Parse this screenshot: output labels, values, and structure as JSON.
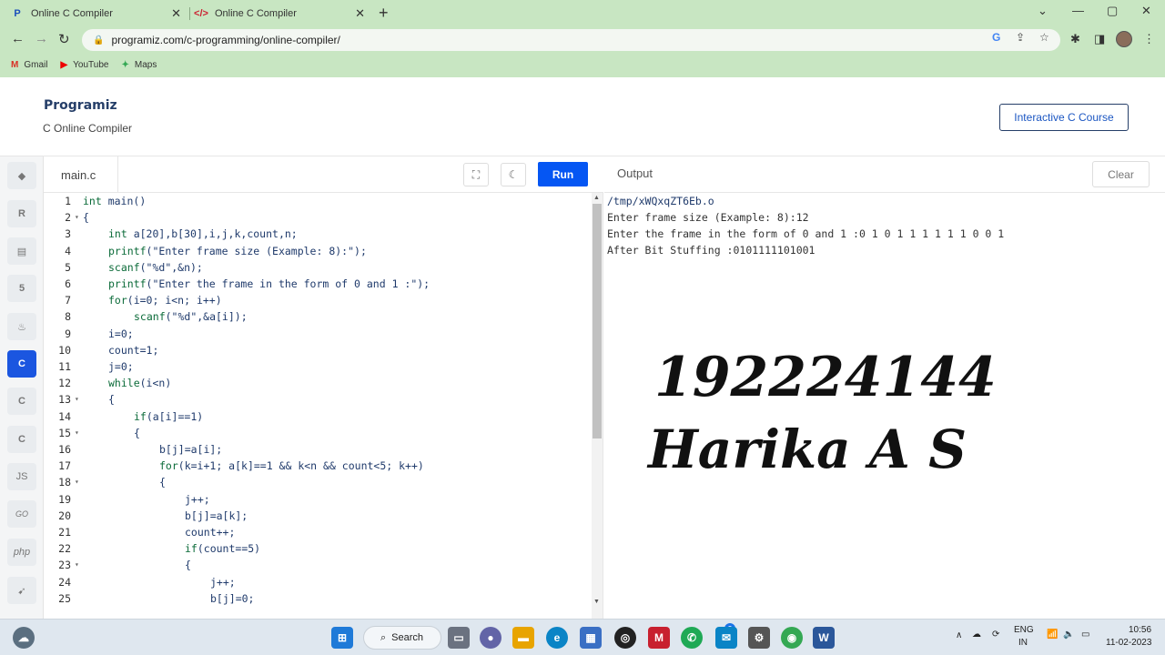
{
  "browser": {
    "tabs": [
      {
        "title": "Online C Compiler",
        "active": true,
        "icon": "programiz-p-icon"
      },
      {
        "title": "Online C Compiler",
        "active": false,
        "icon": "code-icon"
      }
    ],
    "url": "programiz.com/c-programming/online-compiler/",
    "bookmarks": [
      {
        "label": "Gmail",
        "icon": "gmail-icon"
      },
      {
        "label": "YouTube",
        "icon": "youtube-icon"
      },
      {
        "label": "Maps",
        "icon": "maps-icon"
      }
    ]
  },
  "header": {
    "logo": "Programiz",
    "subtitle": "C Online Compiler",
    "course_button": "Interactive C Course"
  },
  "sidebar": {
    "languages": [
      "python",
      "r",
      "sql",
      "html",
      "java",
      "c",
      "cpp",
      "csharp",
      "JS",
      "GO",
      "php",
      "swift"
    ],
    "active": "c"
  },
  "editor": {
    "filename": "main.c",
    "run_label": "Run",
    "lines": [
      {
        "n": "1",
        "fold": false,
        "indent": 0,
        "parts": [
          {
            "t": "int",
            "k": true
          },
          {
            "t": " main()"
          }
        ]
      },
      {
        "n": "2",
        "fold": true,
        "indent": 0,
        "parts": [
          {
            "t": "{"
          }
        ]
      },
      {
        "n": "3",
        "fold": false,
        "indent": 4,
        "parts": [
          {
            "t": "int",
            "k": true
          },
          {
            "t": " a[20],b[30],i,j,k,count,n;"
          }
        ]
      },
      {
        "n": "4",
        "fold": false,
        "indent": 4,
        "parts": [
          {
            "t": "printf",
            "k": true
          },
          {
            "t": "(\"Enter frame size (Example: 8):\");"
          }
        ]
      },
      {
        "n": "5",
        "fold": false,
        "indent": 4,
        "parts": [
          {
            "t": "scanf",
            "k": true
          },
          {
            "t": "(\"%d\",&n);"
          }
        ]
      },
      {
        "n": "6",
        "fold": false,
        "indent": 4,
        "parts": [
          {
            "t": "printf",
            "k": true
          },
          {
            "t": "(\"Enter the frame in the form of 0 and 1 :\");"
          }
        ]
      },
      {
        "n": "7",
        "fold": false,
        "indent": 4,
        "parts": [
          {
            "t": "for",
            "k": true
          },
          {
            "t": "(i=0; i<n; i++)"
          }
        ]
      },
      {
        "n": "8",
        "fold": false,
        "indent": 8,
        "parts": [
          {
            "t": "scanf",
            "k": true
          },
          {
            "t": "(\"%d\",&a[i]);"
          }
        ]
      },
      {
        "n": "9",
        "fold": false,
        "indent": 4,
        "parts": [
          {
            "t": "i=0;"
          }
        ]
      },
      {
        "n": "10",
        "fold": false,
        "indent": 4,
        "parts": [
          {
            "t": "count=1;"
          }
        ]
      },
      {
        "n": "11",
        "fold": false,
        "indent": 4,
        "parts": [
          {
            "t": "j=0;"
          }
        ]
      },
      {
        "n": "12",
        "fold": false,
        "indent": 4,
        "parts": [
          {
            "t": "while",
            "k": true
          },
          {
            "t": "(i<n)"
          }
        ]
      },
      {
        "n": "13",
        "fold": true,
        "indent": 4,
        "parts": [
          {
            "t": "{"
          }
        ]
      },
      {
        "n": "14",
        "fold": false,
        "indent": 8,
        "parts": [
          {
            "t": "if",
            "k": true
          },
          {
            "t": "(a[i]==1)"
          }
        ]
      },
      {
        "n": "15",
        "fold": true,
        "indent": 8,
        "parts": [
          {
            "t": "{"
          }
        ]
      },
      {
        "n": "16",
        "fold": false,
        "indent": 12,
        "parts": [
          {
            "t": "b[j]=a[i];"
          }
        ]
      },
      {
        "n": "17",
        "fold": false,
        "indent": 12,
        "parts": [
          {
            "t": "for",
            "k": true
          },
          {
            "t": "(k=i+1; a[k]==1 && k<n && count<5; k++)"
          }
        ]
      },
      {
        "n": "18",
        "fold": true,
        "indent": 12,
        "parts": [
          {
            "t": "{"
          }
        ]
      },
      {
        "n": "19",
        "fold": false,
        "indent": 16,
        "parts": [
          {
            "t": "j++;"
          }
        ]
      },
      {
        "n": "20",
        "fold": false,
        "indent": 16,
        "parts": [
          {
            "t": "b[j]=a[k];"
          }
        ]
      },
      {
        "n": "21",
        "fold": false,
        "indent": 16,
        "parts": [
          {
            "t": "count++;"
          }
        ]
      },
      {
        "n": "22",
        "fold": false,
        "indent": 16,
        "parts": [
          {
            "t": "if",
            "k": true
          },
          {
            "t": "(count==5)"
          }
        ]
      },
      {
        "n": "23",
        "fold": true,
        "indent": 16,
        "parts": [
          {
            "t": "{"
          }
        ]
      },
      {
        "n": "24",
        "fold": false,
        "indent": 20,
        "parts": [
          {
            "t": "j++;"
          }
        ]
      },
      {
        "n": "25",
        "fold": false,
        "indent": 20,
        "parts": [
          {
            "t": "b[j]=0;"
          }
        ]
      }
    ]
  },
  "output": {
    "title": "Output",
    "clear_label": "Clear",
    "lines": [
      "/tmp/xWQxqZT6Eb.o",
      "Enter frame size (Example: 8):12",
      "Enter the frame in the form of 0 and 1 :0 1 0 1 1 1 1 1 1 0 0 1",
      "After Bit Stuffing :0101111101001"
    ],
    "overlay_id": "192224144",
    "overlay_name": "Harika A S"
  },
  "taskbar": {
    "search_label": "Search",
    "lang_top": "ENG",
    "lang_bottom": "IN",
    "time": "10:56",
    "date": "11-02-2023",
    "badge": "2"
  }
}
